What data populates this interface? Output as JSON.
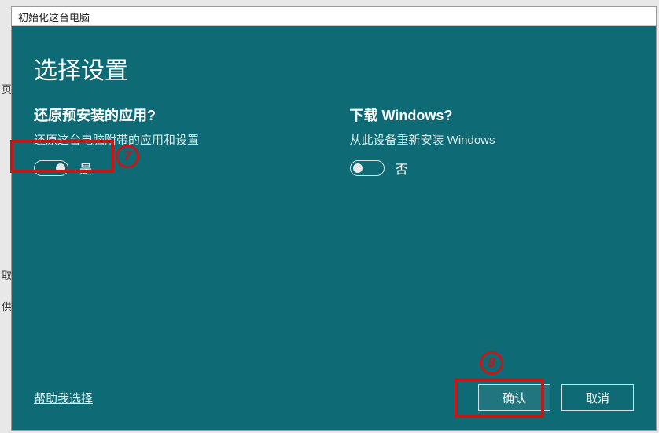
{
  "window": {
    "title": "初始化这台电脑"
  },
  "heading": "选择设置",
  "options": {
    "restore_apps": {
      "title": "还原预安装的应用?",
      "desc": "还原这台电脑附带的应用和设置",
      "state": "是"
    },
    "download_windows": {
      "title": "下载 Windows?",
      "desc": "从此设备重新安装 Windows",
      "state": "否"
    }
  },
  "footer": {
    "help_link": "帮助我选择",
    "confirm": "确认",
    "cancel": "取消"
  },
  "annotations": {
    "num7": "7",
    "num8": "8"
  },
  "background_fragments": {
    "b1": "页",
    "b2": "取",
    "b3": "供"
  }
}
